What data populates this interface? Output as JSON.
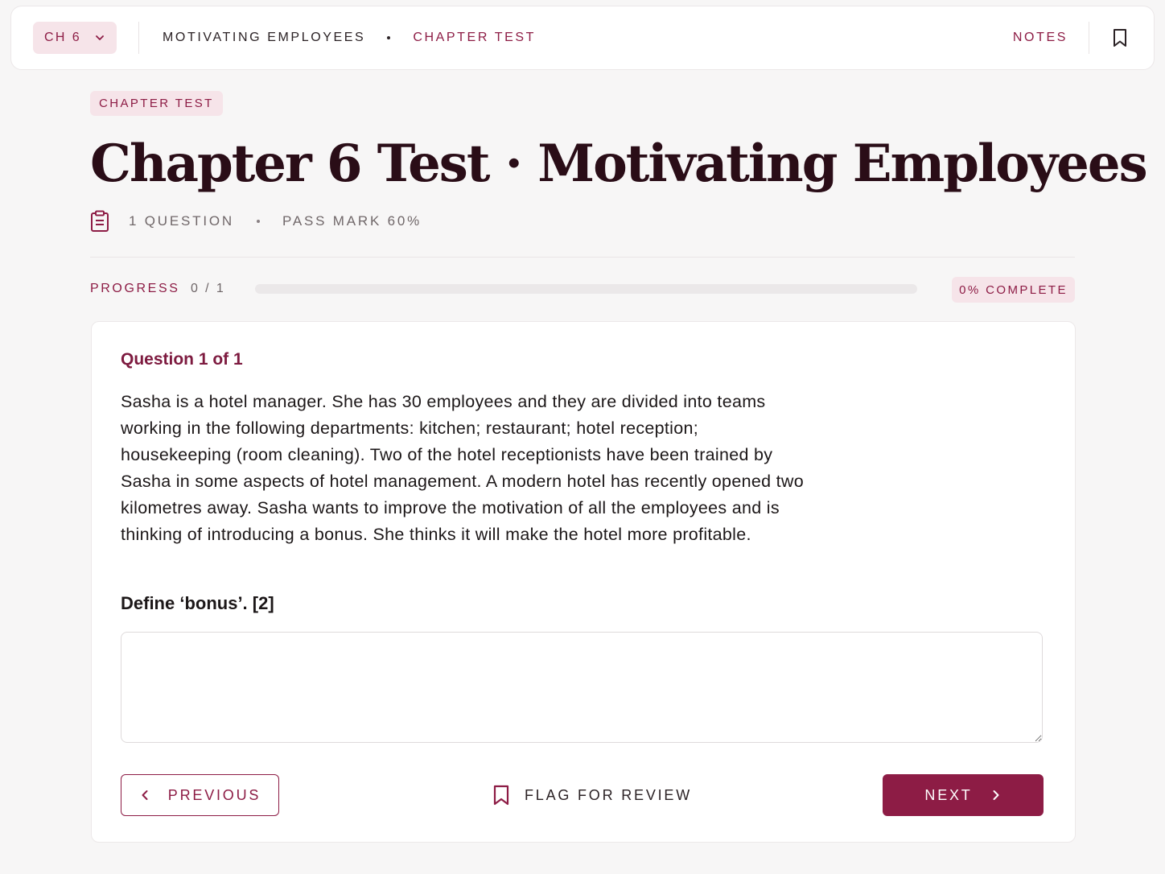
{
  "topbar": {
    "chapter_selector": "CH 6",
    "breadcrumb_section": "MOTIVATING EMPLOYEES",
    "breadcrumb_current": "CHAPTER TEST",
    "notes_label": "NOTES",
    "icons": [
      "chevron-down-icon",
      "bookmark-icon"
    ]
  },
  "header": {
    "tag": "CHAPTER TEST",
    "title": "Chapter 6 Test · Motivating Employees",
    "question_count": "1 QUESTION",
    "pass_mark": "PASS MARK 60%"
  },
  "progress": {
    "label": "PROGRESS",
    "count": "0 / 1",
    "fraction": 0,
    "complete_badge": "0% COMPLETE"
  },
  "question": {
    "number": "Question 1 of 1",
    "body": "Sasha is a hotel manager. She has 30 employees and they are divided into teams working in the following departments: kitchen; restaurant; hotel reception; housekeeping (room cleaning). Two of the hotel receptionists have been trained by Sasha in some aspects of hotel management. A modern hotel has recently opened two kilometres away. Sasha wants to improve the motivation of all the employees and is thinking of introducing a bonus. She thinks it will make the hotel more profitable.",
    "prompt": "Define ‘bonus’. [2]",
    "answer_value": ""
  },
  "actions": {
    "previous": "PREVIOUS",
    "flag": "FLAG FOR REVIEW",
    "next": "NEXT"
  },
  "colors": {
    "accent": "#8d1c45",
    "accent_soft": "#f6e4e9",
    "title": "#2a0d17",
    "background": "#f7f6f6"
  }
}
